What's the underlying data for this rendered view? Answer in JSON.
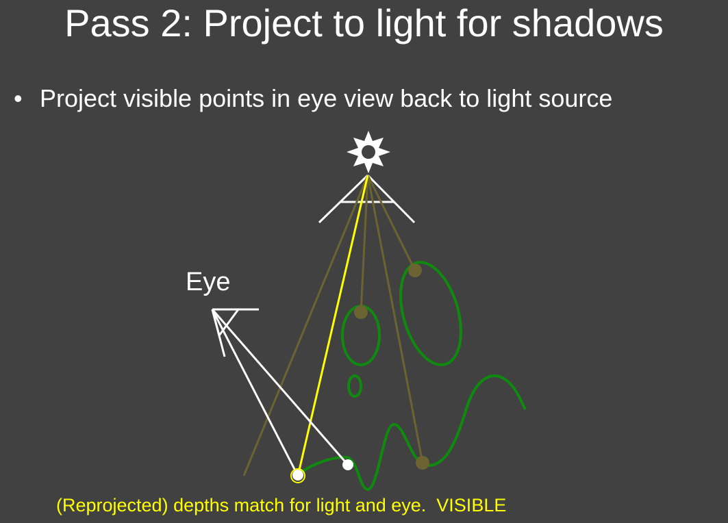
{
  "slide": {
    "title": "Pass 2: Project to light for shadows",
    "bullet_symbol": "•",
    "bullet_text": "Project visible points in eye view back to light source",
    "eye_label": "Eye",
    "caption": "(Reprojected) depths match for light and eye.  VISIBLE"
  },
  "icons": {
    "light_source": "sun-icon"
  },
  "colors": {
    "background": "#414141",
    "text": "#ffffff",
    "caption": "#ffff00",
    "geometry": "#0f8a0f",
    "light_rays": "#6b6432",
    "projection_ray": "#ffff00",
    "eye_rays": "#ffffff"
  }
}
